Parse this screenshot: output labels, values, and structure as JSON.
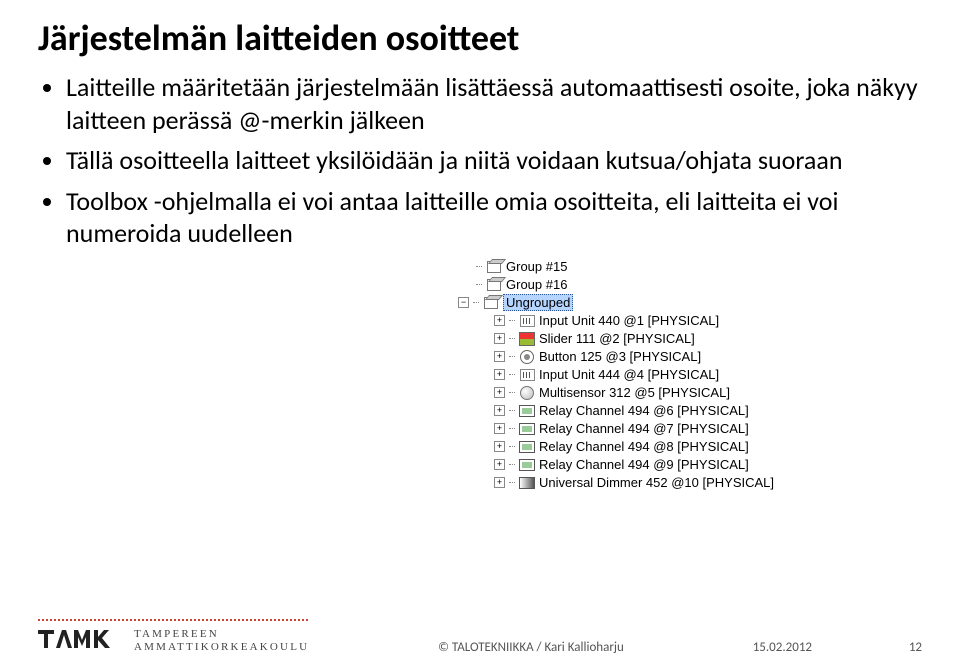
{
  "title": "Järjestelmän laitteiden osoitteet",
  "bullets": [
    "Laitteille määritetään järjestelmään lisättäessä automaattisesti osoite, joka näkyy laitteen perässä @-merkin jälkeen",
    "Tällä osoitteella laitteet yksilöidään ja niitä voidaan kutsua/ohjata suoraan",
    "Toolbox -ohjelmalla ei voi antaa laitteille omia osoitteita, eli laitteita ei voi numeroida uudelleen"
  ],
  "tree": {
    "groups": [
      "Group #15",
      "Group #16"
    ],
    "ungrouped_label": "Ungrouped",
    "items": [
      {
        "icon": "input",
        "label": "Input Unit 440 @1 [PHYSICAL]"
      },
      {
        "icon": "slider",
        "label": "Slider 111 @2 [PHYSICAL]"
      },
      {
        "icon": "btn",
        "label": "Button 125 @3 [PHYSICAL]"
      },
      {
        "icon": "input",
        "label": "Input Unit 444 @4 [PHYSICAL]"
      },
      {
        "icon": "multi",
        "label": "Multisensor 312 @5 [PHYSICAL]"
      },
      {
        "icon": "relay",
        "label": "Relay Channel 494 @6 [PHYSICAL]"
      },
      {
        "icon": "relay",
        "label": "Relay Channel 494 @7 [PHYSICAL]"
      },
      {
        "icon": "relay",
        "label": "Relay Channel 494 @8 [PHYSICAL]"
      },
      {
        "icon": "relay",
        "label": "Relay Channel 494 @9 [PHYSICAL]"
      },
      {
        "icon": "dim",
        "label": "Universal Dimmer 452 @10 [PHYSICAL]"
      }
    ]
  },
  "footer": {
    "brand_line1": "TAMPEREEN",
    "brand_line2": "AMMATTIKORKEAKOULU",
    "center": "© TALOTEKNIIKKA / Kari Kallioharju",
    "date": "15.02.2012",
    "page": "12"
  }
}
